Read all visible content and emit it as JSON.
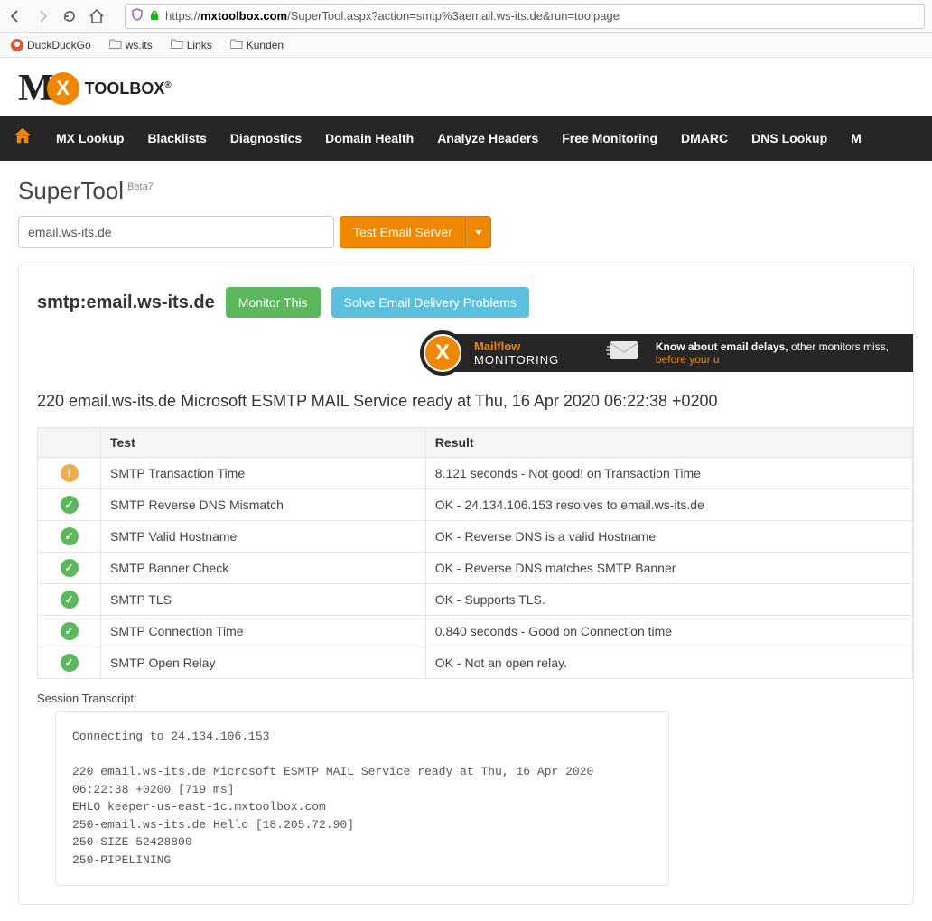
{
  "browser": {
    "url_prefix": "https://",
    "url_host": "mxtoolbox.com",
    "url_path": "/SuperTool.aspx?action=smtp%3aemail.ws-its.de&run=toolpage",
    "bookmarks": [
      "DuckDuckGo",
      "ws.its",
      "Links",
      "Kunden"
    ]
  },
  "logo": {
    "brand": "TOOLBOX",
    "reg": "®"
  },
  "nav": {
    "items": [
      "MX Lookup",
      "Blacklists",
      "Diagnostics",
      "Domain Health",
      "Analyze Headers",
      "Free Monitoring",
      "DMARC",
      "DNS Lookup",
      "M"
    ]
  },
  "page": {
    "title": "SuperTool",
    "beta": "Beta7",
    "input_value": "email.ws-its.de",
    "action_label": "Test Email Server"
  },
  "result": {
    "title": "smtp:email.ws-its.de",
    "monitor_btn": "Monitor This",
    "solve_btn": "Solve Email Delivery Problems",
    "promo_brand": "Mailflow",
    "promo_mon": " MONITORING",
    "promo_text1": "Know about email delays, ",
    "promo_text2": "other monitors miss, ",
    "promo_text3": "before your u",
    "banner": "220 email.ws-its.de Microsoft ESMTP MAIL Service ready at Thu, 16 Apr 2020 06:22:38 +0200",
    "headers": {
      "test": "Test",
      "result": "Result"
    },
    "rows": [
      {
        "status": "warn",
        "test": "SMTP Transaction Time",
        "result": "8.121 seconds - Not good! on Transaction Time"
      },
      {
        "status": "ok",
        "test": "SMTP Reverse DNS Mismatch",
        "result": "OK - 24.134.106.153 resolves to email.ws-its.de"
      },
      {
        "status": "ok",
        "test": "SMTP Valid Hostname",
        "result": "OK - Reverse DNS is a valid Hostname"
      },
      {
        "status": "ok",
        "test": "SMTP Banner Check",
        "result": "OK - Reverse DNS matches SMTP Banner"
      },
      {
        "status": "ok",
        "test": "SMTP TLS",
        "result": "OK - Supports TLS."
      },
      {
        "status": "ok",
        "test": "SMTP Connection Time",
        "result": "0.840 seconds - Good on Connection time"
      },
      {
        "status": "ok",
        "test": "SMTP Open Relay",
        "result": "OK - Not an open relay."
      }
    ],
    "transcript_label": "Session Transcript:",
    "transcript": "Connecting to 24.134.106.153\n\n220 email.ws-its.de Microsoft ESMTP MAIL Service ready at Thu, 16 Apr 2020 06:22:38 +0200 [719 ms]\nEHLO keeper-us-east-1c.mxtoolbox.com\n250-email.ws-its.de Hello [18.205.72.90]\n250-SIZE 52428800\n250-PIPELINING"
  }
}
